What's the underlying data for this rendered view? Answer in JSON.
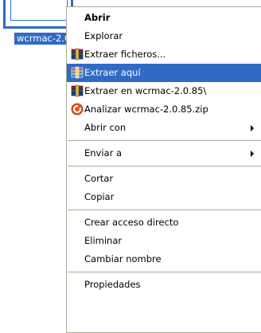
{
  "file": {
    "label": "wcrmac-2.0.85.zip"
  },
  "menu": {
    "open": "Abrir",
    "explore": "Explorar",
    "extract_files": "Extraer ficheros...",
    "extract_here": "Extraer aquí",
    "extract_to": "Extraer en wcrmac-2.0.85\\",
    "analyze": "Analizar wcrmac-2.0.85.zip",
    "open_with": "Abrir con",
    "send_to": "Enviar a",
    "cut": "Cortar",
    "copy": "Copiar",
    "create_shortcut": "Crear acceso directo",
    "delete": "Eliminar",
    "rename": "Cambiar nombre",
    "properties": "Propiedades"
  },
  "icons": {
    "extract_files": "winrar-archive-icon",
    "extract_here": "winrar-archive-icon",
    "extract_to": "winrar-archive-icon",
    "analyze": "antivirus-scan-icon"
  },
  "colors": {
    "selection": "#316ac5",
    "menu_border": "#aca899"
  }
}
